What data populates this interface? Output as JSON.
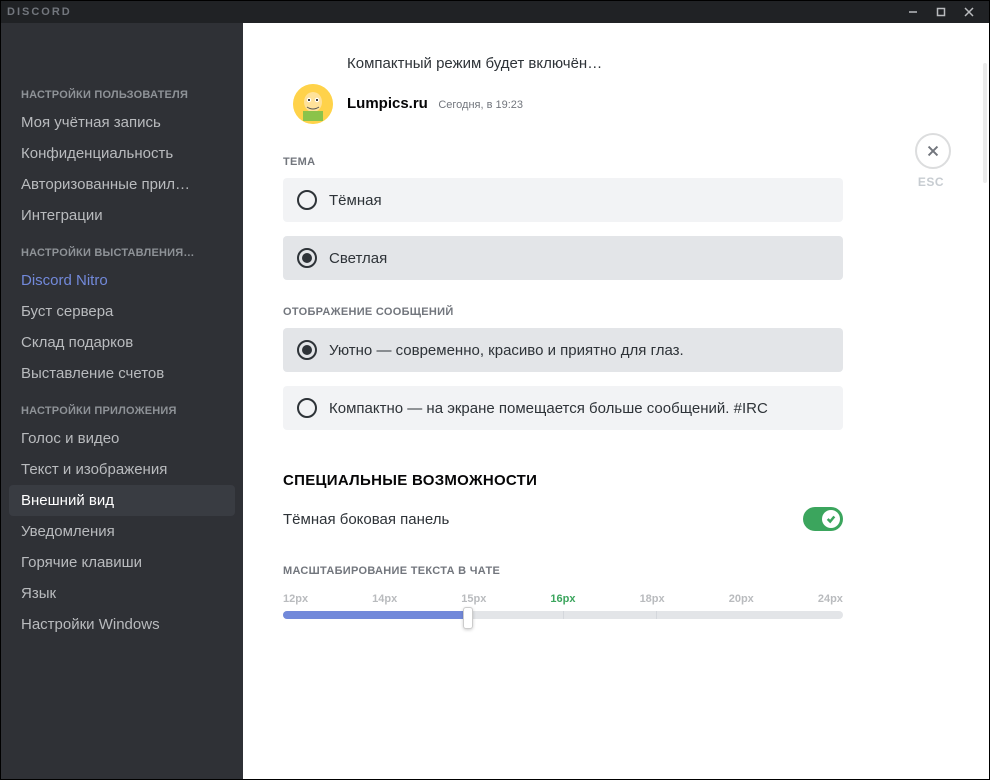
{
  "app": {
    "logo": "DISCORD",
    "esc": "ESC"
  },
  "sidebar": {
    "headers": {
      "user": "НАСТРОЙКИ ПОЛЬЗОВАТЕЛЯ",
      "billing": "НАСТРОЙКИ ВЫСТАВЛЕНИЯ…",
      "app": "НАСТРОЙКИ ПРИЛОЖЕНИЯ"
    },
    "items": {
      "account": "Моя учётная запись",
      "privacy": "Конфиденциальность",
      "authorized": "Авторизованные прил…",
      "integrations": "Интеграции",
      "nitro": "Discord Nitro",
      "boost": "Буст сервера",
      "inventory": "Склад подарков",
      "billing": "Выставление счетов",
      "voice": "Голос и видео",
      "text": "Текст и изображения",
      "appearance": "Внешний вид",
      "notifications": "Уведомления",
      "keybinds": "Горячие клавиши",
      "language": "Язык",
      "windows": "Настройки Windows"
    }
  },
  "preview": {
    "compact_text": "Компактный режим будет включён…",
    "username": "Lumpics.ru",
    "timestamp": "Сегодня, в 19:23"
  },
  "theme": {
    "title": "ТЕМА",
    "dark": "Тёмная",
    "light": "Светлая"
  },
  "display": {
    "title": "ОТОБРАЖЕНИЕ СООБЩЕНИЙ",
    "cozy": "Уютно — современно, красиво и приятно для глаз.",
    "compact": "Компактно — на экране помещается больше сообщений. #IRC"
  },
  "accessibility": {
    "title": "СПЕЦИАЛЬНЫЕ ВОЗМОЖНОСТИ",
    "dark_sidebar": "Тёмная боковая панель"
  },
  "scaling": {
    "title": "МАСШТАБИРОВАНИЕ ТЕКСТА В ЧАТЕ",
    "ticks": [
      "12px",
      "14px",
      "15px",
      "16px",
      "18px",
      "20px",
      "24px"
    ],
    "selected": "16px"
  }
}
